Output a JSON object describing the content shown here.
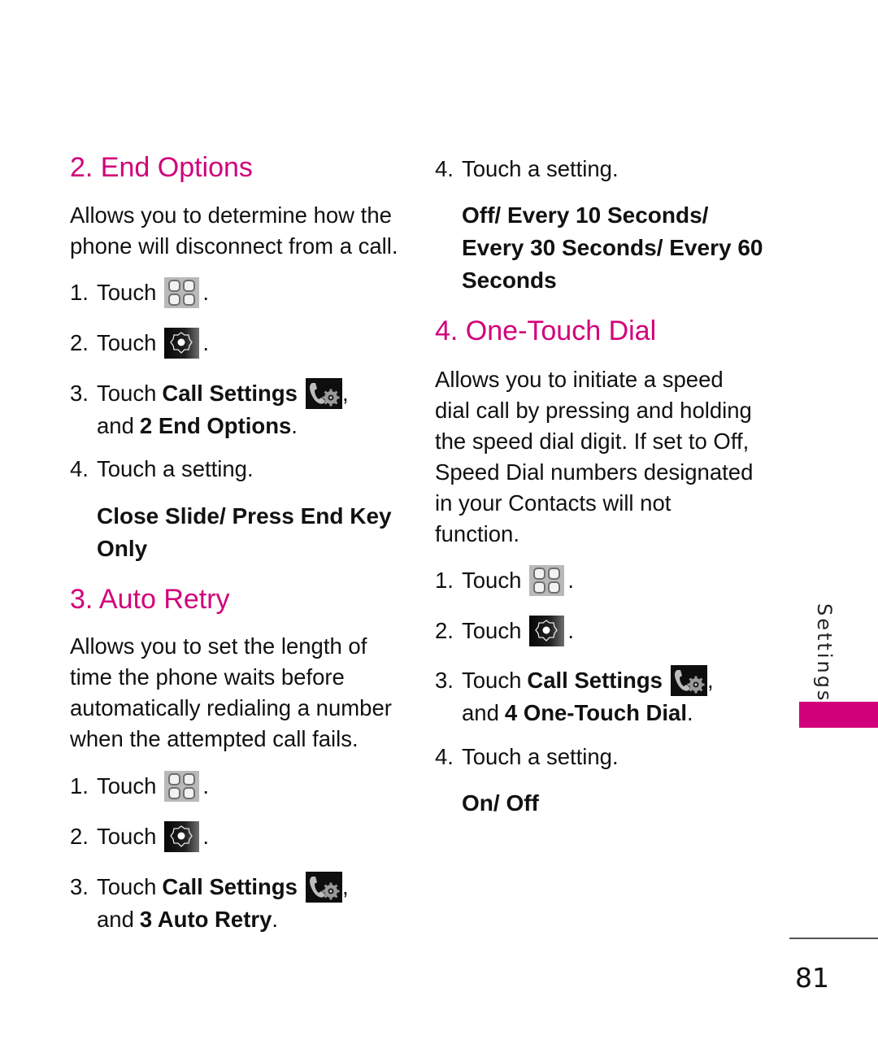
{
  "colors": {
    "accent": "#d1007a",
    "text": "#111111"
  },
  "sections": {
    "end_options": {
      "heading": "2. End Options",
      "description": [
        "Allows you to determine how the",
        "phone will disconnect from a call."
      ],
      "steps": [
        {
          "num": "1.",
          "text": "Touch",
          "icon": "menu-grid-icon",
          "suffix": "."
        },
        {
          "num": "2.",
          "text": "Touch",
          "icon": "settings-gear-icon",
          "suffix": "."
        },
        {
          "num": "3.",
          "text": "Touch",
          "bold": "Call Settings",
          "icon": "call-settings-icon",
          "suffix": ",",
          "line2_prefix": "and",
          "line2_bold": "2 End Options",
          "line2_suffix": "."
        },
        {
          "num": "4.",
          "text": "Touch a setting."
        }
      ],
      "options": [
        "Close Slide/ Press End Key",
        "Only"
      ]
    },
    "auto_retry": {
      "heading": "3. Auto Retry",
      "description": [
        "Allows you to set the length of",
        "time the phone waits before",
        "automatically redialing a number",
        "when the attempted call fails."
      ],
      "steps": [
        {
          "num": "1.",
          "text": "Touch",
          "icon": "menu-grid-icon",
          "suffix": "."
        },
        {
          "num": "2.",
          "text": "Touch",
          "icon": "settings-gear-icon",
          "suffix": "."
        },
        {
          "num": "3.",
          "text": "Touch",
          "bold": "Call Settings",
          "icon": "call-settings-icon",
          "suffix": ",",
          "line2_prefix": "and",
          "line2_bold": "3 Auto Retry",
          "line2_suffix": "."
        },
        {
          "num": "4.",
          "text": "Touch a setting."
        }
      ],
      "options": [
        "Off/ Every 10 Seconds/",
        "Every 30 Seconds/ Every 60",
        "Seconds"
      ]
    },
    "one_touch_dial": {
      "heading": "4. One-Touch Dial",
      "description": [
        "Allows you to initiate a speed",
        "dial call by pressing and holding",
        "the speed dial digit. If set to Off,",
        "Speed Dial numbers designated",
        "in your Contacts will not",
        "function."
      ],
      "steps": [
        {
          "num": "1.",
          "text": "Touch",
          "icon": "menu-grid-icon",
          "suffix": "."
        },
        {
          "num": "2.",
          "text": "Touch",
          "icon": "settings-gear-icon",
          "suffix": "."
        },
        {
          "num": "3.",
          "text": "Touch",
          "bold": "Call Settings",
          "icon": "call-settings-icon",
          "suffix": ",",
          "line2_prefix": "and",
          "line2_bold": "4 One-Touch Dial",
          "line2_suffix": "."
        },
        {
          "num": "4.",
          "text": "Touch a setting."
        }
      ],
      "options": [
        "On/ Off"
      ]
    }
  },
  "side_tab": {
    "label": "Settings"
  },
  "page_number": "81"
}
